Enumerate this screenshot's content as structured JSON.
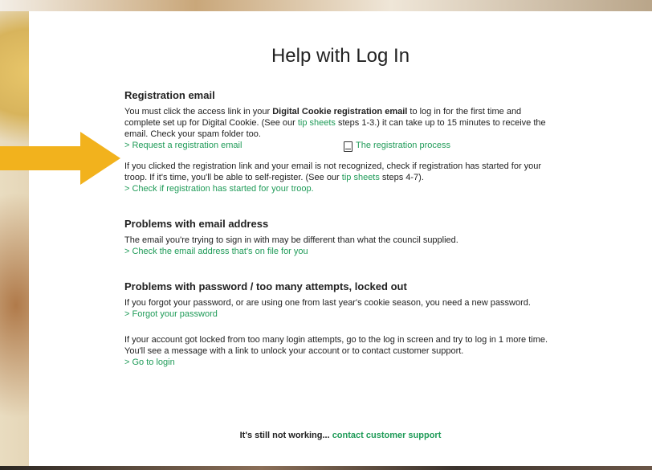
{
  "page": {
    "title": "Help with Log In"
  },
  "registration": {
    "heading": "Registration email",
    "p1_pre": "You must click the access link in your ",
    "p1_bold": "Digital Cookie registration email",
    "p1_mid": " to log in for the first time and complete set up for Digital Cookie. (See our ",
    "p1_link": "tip sheets",
    "p1_post": " steps 1-3.) it can take up to 15 minutes to receive the email. Check your spam folder too.",
    "request_link": "> Request a registration email",
    "process_link": "The registration process",
    "p2_pre": "If you clicked the registration link and your email is not recognized, check if registration has started for your troop. If it's time, you'll be able to self-register. (See our ",
    "p2_link": "tip sheets",
    "p2_post": " steps 4-7).",
    "check_link": "> Check if registration has started for your troop."
  },
  "email": {
    "heading": "Problems with email address",
    "p1": "The email you're trying to sign in with may be different than what the council supplied.",
    "check_link": "> Check the email address that's on file for you"
  },
  "password": {
    "heading": "Problems with password / too many attempts, locked out",
    "p1": "If you forgot your password, or are using one from last year's cookie season, you need a new password.",
    "forgot_link": "> Forgot your password",
    "p2": "If your account got locked from too many login attempts, go to the log in screen and try to log in 1 more time. You'll see a message with a link to unlock your account or to contact customer support.",
    "login_link": "> Go to login"
  },
  "footer": {
    "text": "It's still not working... ",
    "link": "contact customer support"
  },
  "colors": {
    "link": "#1f9b58",
    "arrow": "#f2b21d"
  },
  "icons": {
    "arrow": "arrow-right-icon",
    "document": "document-icon"
  }
}
